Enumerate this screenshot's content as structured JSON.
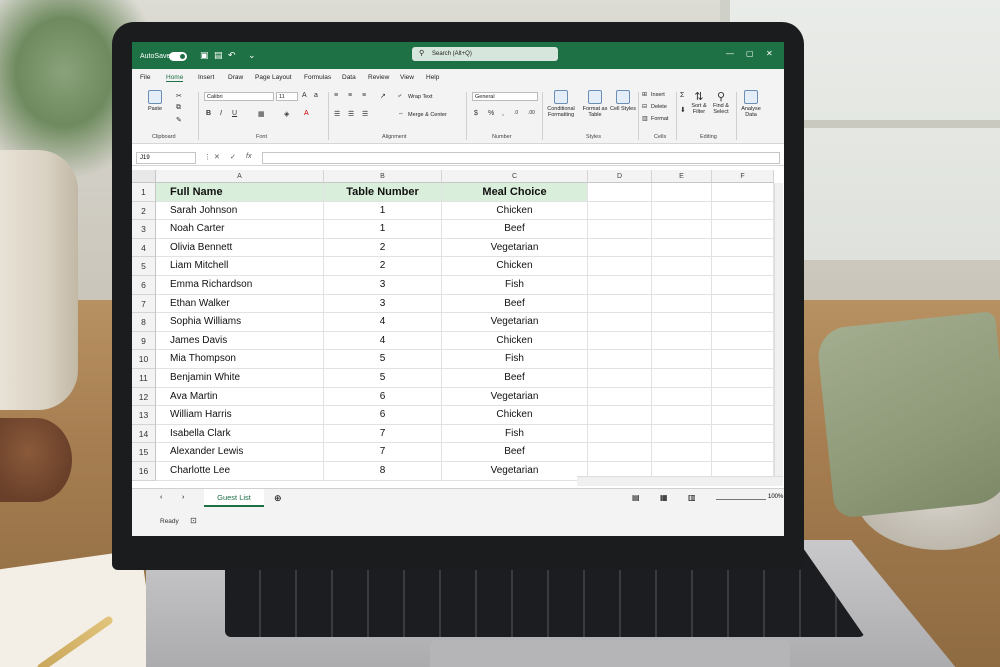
{
  "titlebar": {
    "autosave_label": "AutoSave",
    "search_placeholder": "Search (Alt+Q)"
  },
  "menu": [
    "File",
    "Home",
    "Insert",
    "Draw",
    "Page Layout",
    "Formulas",
    "Data",
    "Review",
    "View",
    "Help"
  ],
  "ribbon": {
    "font_name": "Calibri",
    "font_size": "11",
    "number_format": "General",
    "paste_label": "Paste",
    "wrap_text": "Wrap Text",
    "merge_center": "Merge & Center",
    "conditional_formatting": "Conditional Formatting",
    "format_as_table": "Format as Table",
    "cell_styles": "Cell Styles",
    "insert": "Insert",
    "delete": "Delete",
    "format": "Format",
    "sort_filter": "Sort & Filter",
    "find_select": "Find & Select",
    "analyse_data": "Analyse Data",
    "groups": {
      "clipboard": "Clipboard",
      "font": "Font",
      "alignment": "Alignment",
      "number": "Number",
      "styles": "Styles",
      "cells": "Cells",
      "editing": "Editing"
    }
  },
  "formula_bar": {
    "name_box": "J19",
    "fx": "fx",
    "value": ""
  },
  "columns": [
    "A",
    "B",
    "C",
    "D",
    "E",
    "F"
  ],
  "headers": {
    "a": "Full Name",
    "b": "Table Number",
    "c": "Meal Choice"
  },
  "rows": [
    {
      "num": "1"
    },
    {
      "num": "2",
      "name": "Sarah Johnson",
      "table": "1",
      "meal": "Chicken"
    },
    {
      "num": "3",
      "name": "Noah Carter",
      "table": "1",
      "meal": "Beef"
    },
    {
      "num": "4",
      "name": "Olivia Bennett",
      "table": "2",
      "meal": "Vegetarian"
    },
    {
      "num": "5",
      "name": "Liam Mitchell",
      "table": "2",
      "meal": "Chicken"
    },
    {
      "num": "6",
      "name": "Emma Richardson",
      "table": "3",
      "meal": "Fish"
    },
    {
      "num": "7",
      "name": "Ethan Walker",
      "table": "3",
      "meal": "Beef"
    },
    {
      "num": "8",
      "name": "Sophia Williams",
      "table": "4",
      "meal": "Vegetarian"
    },
    {
      "num": "9",
      "name": "James Davis",
      "table": "4",
      "meal": "Chicken"
    },
    {
      "num": "10",
      "name": "Mia Thompson",
      "table": "5",
      "meal": "Fish"
    },
    {
      "num": "11",
      "name": "Benjamin White",
      "table": "5",
      "meal": "Beef"
    },
    {
      "num": "12",
      "name": "Ava Martin",
      "table": "6",
      "meal": "Vegetarian"
    },
    {
      "num": "13",
      "name": "William Harris",
      "table": "6",
      "meal": "Chicken"
    },
    {
      "num": "14",
      "name": "Isabella Clark",
      "table": "7",
      "meal": "Fish"
    },
    {
      "num": "15",
      "name": "Alexander Lewis",
      "table": "7",
      "meal": "Beef"
    },
    {
      "num": "16",
      "name": "Charlotte Lee",
      "table": "8",
      "meal": "Vegetarian"
    }
  ],
  "sheet_tab": "Guest List",
  "status": {
    "ready": "Ready",
    "zoom": "100%"
  },
  "colors": {
    "excel_green": "#1e7145",
    "header_fill": "#d9efdc"
  }
}
